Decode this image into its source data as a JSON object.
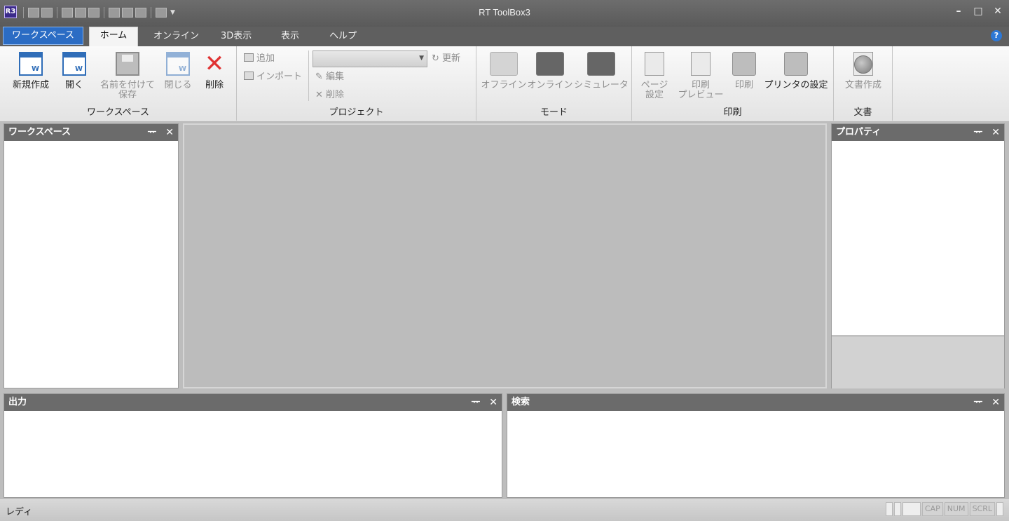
{
  "window": {
    "title": "RT ToolBox3",
    "app_icon_text": "R3",
    "controls": {
      "minimize": "–",
      "maximize": "□",
      "close": "✕"
    }
  },
  "tabs": {
    "file": "ワークスペース",
    "home": "ホーム",
    "online": "オンライン",
    "view3d": "3D表示",
    "view": "表示",
    "help": "ヘルプ",
    "help_icon": "?"
  },
  "ribbon": {
    "workspace_group": {
      "label": "ワークスペース",
      "new": "新規作成",
      "open": "開く",
      "save_as_line1": "名前を付けて",
      "save_as_line2": "保存",
      "close": "閉じる",
      "delete": "削除"
    },
    "project_group": {
      "label": "プロジェクト",
      "add": "追加",
      "import": "インポート",
      "edit": "編集",
      "delete": "削除",
      "update": "更新"
    },
    "mode_group": {
      "label": "モード",
      "offline": "オフライン",
      "online": "オンライン",
      "simulator": "シミュレータ"
    },
    "print_group": {
      "label": "印刷",
      "page_setup_line1": "ページ",
      "page_setup_line2": "設定",
      "preview_line1": "印刷",
      "preview_line2": "プレビュー",
      "print": "印刷",
      "printer_settings": "プリンタの設定"
    },
    "document_group": {
      "label": "文書",
      "create": "文書作成"
    }
  },
  "panels": {
    "workspace": "ワークスペース",
    "properties": "プロパティ",
    "output": "出力",
    "search": "検索",
    "pin": "ᅲ",
    "close": "✕"
  },
  "statusbar": {
    "text": "レディ",
    "cap": "CAP",
    "num": "NUM",
    "scrl": "SCRL"
  }
}
